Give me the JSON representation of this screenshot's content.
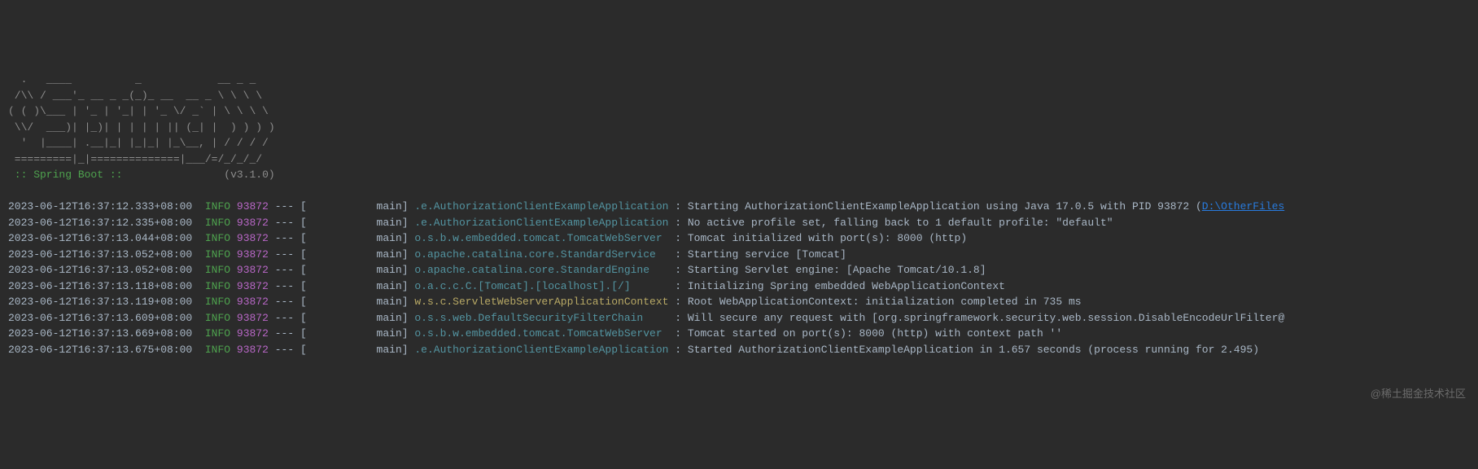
{
  "banner": {
    "line1": "  .   ____          _            __ _ _",
    "line2": " /\\\\ / ___'_ __ _ _(_)_ __  __ _ \\ \\ \\ \\",
    "line3": "( ( )\\___ | '_ | '_| | '_ \\/ _` | \\ \\ \\ \\",
    "line4": " \\\\/  ___)| |_)| | | | | || (_| |  ) ) ) )",
    "line5": "  '  |____| .__|_| |_|_| |_\\__, | / / / /",
    "line6": " =========|_|==============|___/=/_/_/_/",
    "springBootLabel": " :: Spring Boot :: ",
    "version": "(v3.1.0)"
  },
  "logs": [
    {
      "timestamp": "2023-06-12T16:37:12.333+08:00",
      "level": "INFO",
      "pid": "93872",
      "separator": "---",
      "thread": "[           main]",
      "logger": ".e.AuthorizationClientExampleApplication",
      "loggerClass": "logger",
      "message": "Starting AuthorizationClientExampleApplication using Java 17.0.5 with PID 93872 (",
      "link": "D:\\OtherFiles",
      "hasLink": true
    },
    {
      "timestamp": "2023-06-12T16:37:12.335+08:00",
      "level": "INFO",
      "pid": "93872",
      "separator": "---",
      "thread": "[           main]",
      "logger": ".e.AuthorizationClientExampleApplication",
      "loggerClass": "logger",
      "message": "No active profile set, falling back to 1 default profile: \"default\""
    },
    {
      "timestamp": "2023-06-12T16:37:13.044+08:00",
      "level": "INFO",
      "pid": "93872",
      "separator": "---",
      "thread": "[           main]",
      "logger": "o.s.b.w.embedded.tomcat.TomcatWebServer ",
      "loggerClass": "logger",
      "message": "Tomcat initialized with port(s): 8000 (http)"
    },
    {
      "timestamp": "2023-06-12T16:37:13.052+08:00",
      "level": "INFO",
      "pid": "93872",
      "separator": "---",
      "thread": "[           main]",
      "logger": "o.apache.catalina.core.StandardService  ",
      "loggerClass": "logger",
      "message": "Starting service [Tomcat]"
    },
    {
      "timestamp": "2023-06-12T16:37:13.052+08:00",
      "level": "INFO",
      "pid": "93872",
      "separator": "---",
      "thread": "[           main]",
      "logger": "o.apache.catalina.core.StandardEngine   ",
      "loggerClass": "logger",
      "message": "Starting Servlet engine: [Apache Tomcat/10.1.8]"
    },
    {
      "timestamp": "2023-06-12T16:37:13.118+08:00",
      "level": "INFO",
      "pid": "93872",
      "separator": "---",
      "thread": "[           main]",
      "logger": "o.a.c.c.C.[Tomcat].[localhost].[/]      ",
      "loggerClass": "logger",
      "message": "Initializing Spring embedded WebApplicationContext"
    },
    {
      "timestamp": "2023-06-12T16:37:13.119+08:00",
      "level": "INFO",
      "pid": "93872",
      "separator": "---",
      "thread": "[           main]",
      "logger": "w.s.c.ServletWebServerApplicationContext",
      "loggerClass": "logger-yellow",
      "message": "Root WebApplicationContext: initialization completed in 735 ms"
    },
    {
      "timestamp": "2023-06-12T16:37:13.609+08:00",
      "level": "INFO",
      "pid": "93872",
      "separator": "---",
      "thread": "[           main]",
      "logger": "o.s.s.web.DefaultSecurityFilterChain    ",
      "loggerClass": "logger",
      "message": "Will secure any request with [org.springframework.security.web.session.DisableEncodeUrlFilter@"
    },
    {
      "timestamp": "2023-06-12T16:37:13.669+08:00",
      "level": "INFO",
      "pid": "93872",
      "separator": "---",
      "thread": "[           main]",
      "logger": "o.s.b.w.embedded.tomcat.TomcatWebServer ",
      "loggerClass": "logger",
      "message": "Tomcat started on port(s): 8000 (http) with context path ''"
    },
    {
      "timestamp": "2023-06-12T16:37:13.675+08:00",
      "level": "INFO",
      "pid": "93872",
      "separator": "---",
      "thread": "[           main]",
      "logger": ".e.AuthorizationClientExampleApplication",
      "loggerClass": "logger",
      "message": "Started AuthorizationClientExampleApplication in 1.657 seconds (process running for 2.495)"
    }
  ],
  "watermark": "@稀土掘金技术社区"
}
